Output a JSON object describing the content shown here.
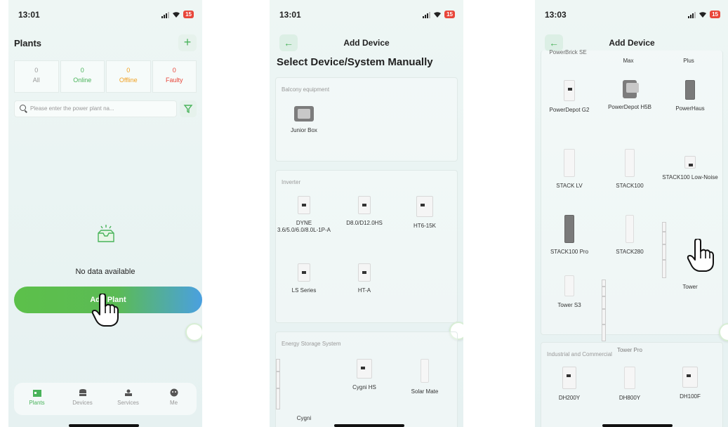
{
  "phones": [
    {
      "time": "13:01",
      "battery": "15",
      "title": "Plants",
      "stats": [
        {
          "value": "0",
          "label": "All",
          "color": "#999999"
        },
        {
          "value": "0",
          "label": "Online",
          "color": "#49b35a"
        },
        {
          "value": "0",
          "label": "Offline",
          "color": "#f0a020"
        },
        {
          "value": "0",
          "label": "Faulty",
          "color": "#e8463a"
        }
      ],
      "search_placeholder": "Please enter the power plant na...",
      "empty_text": "No data available",
      "add_button": "Add Plant",
      "nav": [
        "Plants",
        "Devices",
        "Services",
        "Me"
      ]
    },
    {
      "time": "13:01",
      "battery": "15",
      "header": "Add Device",
      "title": "Select Device/System Manually",
      "sections": [
        {
          "label": "Balcony equipment",
          "devices": [
            "Junior Box"
          ]
        },
        {
          "label": "Inverter",
          "devices": [
            "DYNE 3.6/5.0/6.0/8.0L-1P-A",
            "D8.0/D12.0HS",
            "HT6-15K",
            "LS Series",
            "HT-A"
          ]
        },
        {
          "label": "Energy Storage System",
          "devices": [
            "Cygni",
            "Cygni HS",
            "Solar Mate"
          ]
        }
      ]
    },
    {
      "time": "13:03",
      "battery": "15",
      "header": "Add Device",
      "top_partial": [
        "PowerBrick SE",
        "Max",
        "Plus"
      ],
      "devices": [
        "PowerDepot G2",
        "PowerDepot H5B",
        "PowerHaus",
        "STACK LV",
        "STACK100",
        "STACK100 Low-Noise",
        "STACK100 Pro",
        "STACK280",
        "Tower",
        "Tower S3",
        "Tower Pro"
      ],
      "section2_label": "Industrial and Commercial",
      "section2_devices": [
        "DH200Y",
        "DH800Y",
        "DH100F"
      ]
    }
  ]
}
